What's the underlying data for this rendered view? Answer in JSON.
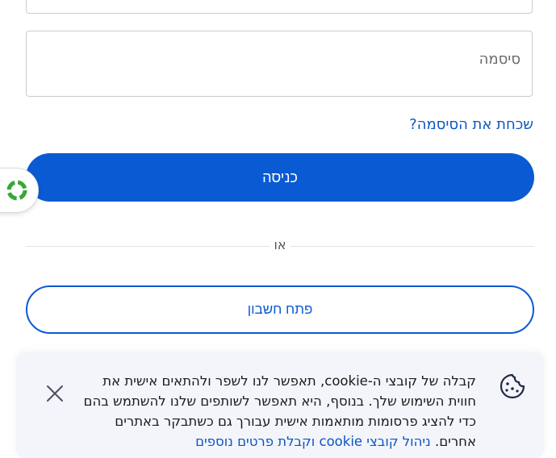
{
  "login": {
    "password_placeholder": "סיסמה",
    "forgot_password": "שכחת את הסיסמה?",
    "submit_label": "כניסה",
    "divider_text": "או",
    "create_account": "פתח חשבון"
  },
  "cookie_banner": {
    "text": "קבלה של קובצי ה-cookie, תאפשר לנו לשפר ולהתאים אישית את חווית השימוש שלך. בנוסף, היא תאפשר לשותפים שלנו להשתמש בהם כדי להציג פרסומות מותאמות אישית עבורך גם כשתבקר באתרים אחרים.",
    "manage_link": "ניהול קובצי cookie וקבלת פרטים נוספים",
    "cookie_icon": "cookie-icon",
    "close_icon": "close-icon"
  },
  "widget": {
    "icon": "circular-arrows-icon"
  },
  "colors": {
    "primary": "#0a5ad4",
    "link": "#0a56c2",
    "banner_bg": "#f3f5fb",
    "widget_green": "#3aa637"
  }
}
